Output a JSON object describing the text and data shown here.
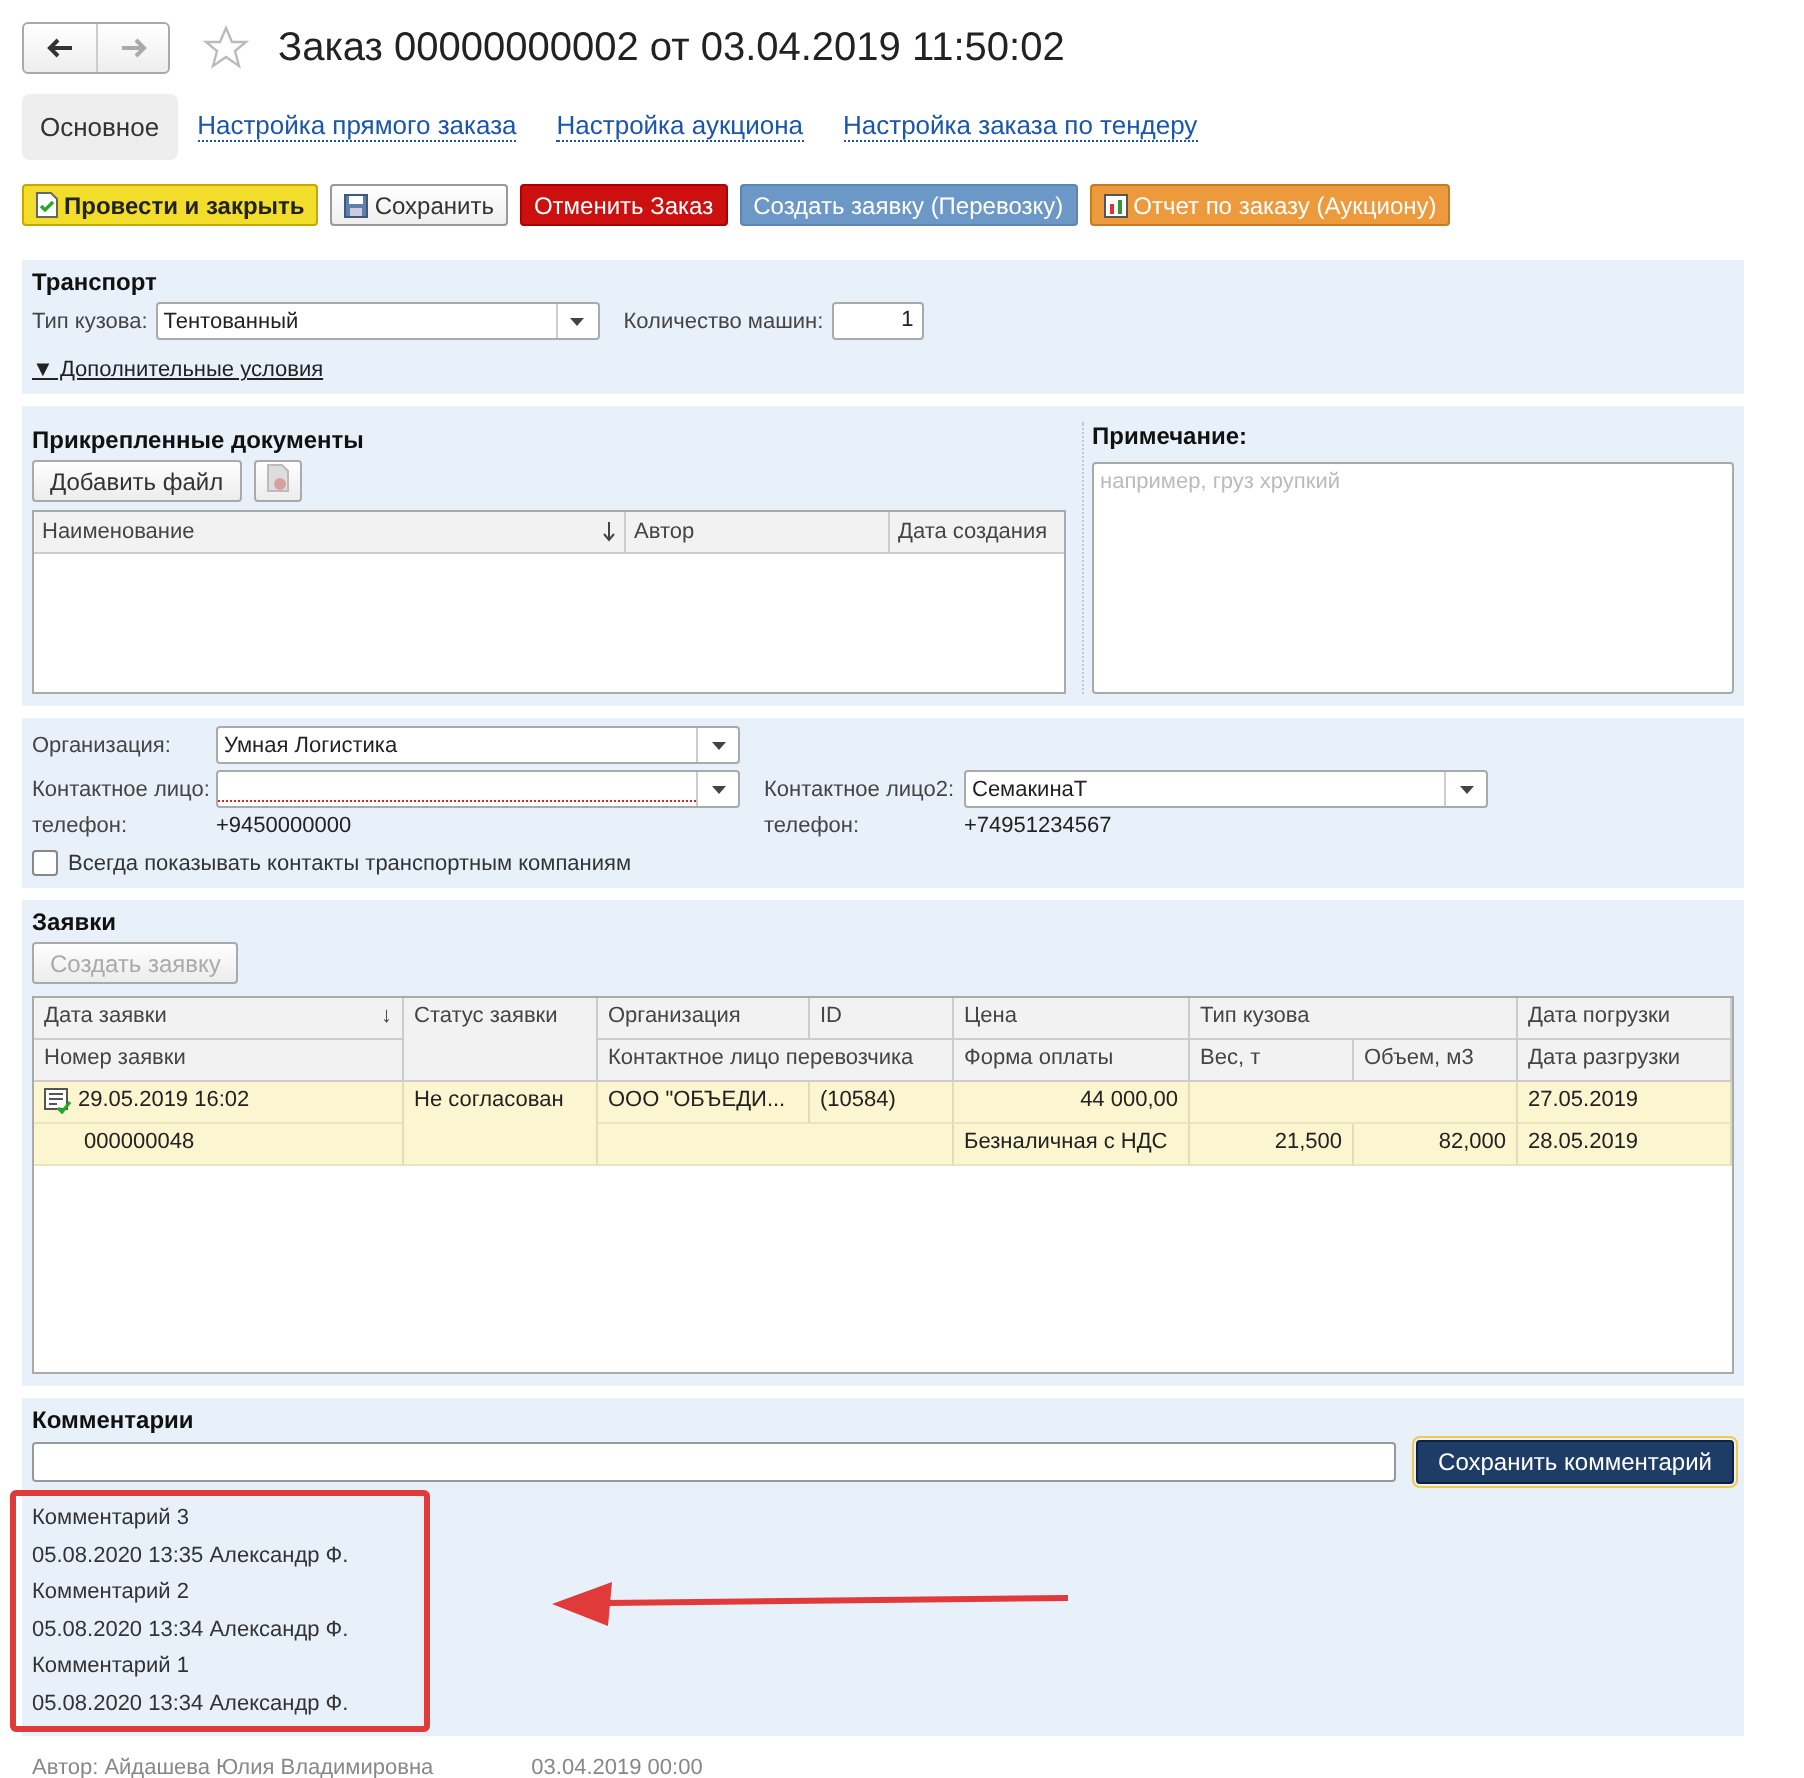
{
  "title": "Заказ 00000000002 от 03.04.2019 11:50:02",
  "favorite": false,
  "tabs": [
    {
      "label": "Основное",
      "selected": true
    },
    {
      "label": "Настройка прямого заказа",
      "selected": false
    },
    {
      "label": "Настройка аукциона",
      "selected": false
    },
    {
      "label": "Настройка заказа по тендеру",
      "selected": false
    }
  ],
  "toolbar": [
    {
      "label": "Провести и закрыть",
      "kind": "primary"
    },
    {
      "label": "Сохранить",
      "kind": "save"
    },
    {
      "label": "Отменить Заказ",
      "kind": "danger"
    },
    {
      "label": "Создать заявку (Перевозку)",
      "kind": "info"
    },
    {
      "label": "Отчет по заказу (Аукциону)",
      "kind": "report"
    }
  ],
  "transport": {
    "title": "Транспорт",
    "body_label": "Тип кузова:",
    "body_value": "Тентованный",
    "count_label": "Количество машин:",
    "count_value": "1",
    "extra_link": "▼ Дополнительные условия"
  },
  "documents": {
    "title": "Прикрепленные документы",
    "add_button": "Добавить файл",
    "columns": [
      {
        "label": "Наименование",
        "sorted": true
      },
      {
        "label": "Автор",
        "sorted": false
      },
      {
        "label": "Дата создания",
        "sorted": false
      }
    ]
  },
  "note": {
    "label": "Примечание:",
    "placeholder": "например, груз хрупкий"
  },
  "contacts": {
    "org_label": "Организация:",
    "org_value": "Умная Логистика",
    "contact_label": "Контактное лицо:",
    "contact_required": true,
    "contact2_label": "Контактное лицо2:",
    "contact2_value": "СемакинаТ",
    "phone_label": "телефон:",
    "phone": "+9450000000",
    "phone2_label": "телефон:",
    "phone2": "+74951234567",
    "always_show": {
      "label": "Всегда показывать контакты транспортным компаниям",
      "checked": false
    }
  },
  "requests": {
    "title": "Заявки",
    "create_button": "Создать заявку",
    "create_disabled": true,
    "header_top": [
      "Дата заявки",
      "Статус заявки",
      "Организация",
      "ID",
      "Цена",
      "Тип кузова",
      "Дата погрузки"
    ],
    "sort_mark": "↓",
    "header_bottom": [
      "Номер заявки",
      "Контактное лицо перевозчика",
      "Форма оплаты",
      "Вес, т",
      "Объем, м3",
      "Дата разгрузки"
    ],
    "rows": [
      {
        "selected": true,
        "date": "29.05.2019 16:02",
        "number": "000000048",
        "status": "Не согласован",
        "org": "ООО \"ОБЪЕДИ...",
        "id": "(10584)",
        "price": "44 000,00",
        "payment": "Безналичная с НДС",
        "weight": "21,500",
        "volume": "82,000",
        "load_date": "27.05.2019",
        "unload_date": "28.05.2019"
      }
    ]
  },
  "comments": {
    "title": "Комментарии",
    "save_button": "Сохранить комментарий",
    "items": [
      {
        "text": "Комментарий 3",
        "meta": "05.08.2020 13:35 Александр Ф."
      },
      {
        "text": "Комментарий 2",
        "meta": "05.08.2020 13:34 Александр Ф."
      },
      {
        "text": "Комментарий 1",
        "meta": "05.08.2020 13:34 Александр Ф."
      }
    ]
  },
  "footer": {
    "author": "Автор: Айдашева Юлия Владимировна",
    "date": "03.04.2019 00:00"
  }
}
